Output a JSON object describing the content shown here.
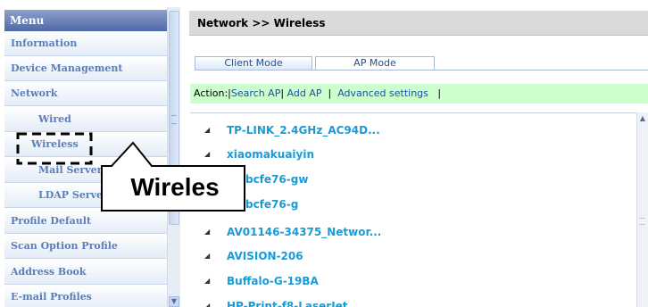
{
  "menu": {
    "title": "Menu",
    "items": [
      {
        "label": "Information"
      },
      {
        "label": "Device Management"
      },
      {
        "label": "Network"
      },
      {
        "label": "Wired"
      },
      {
        "label": "Wireless"
      },
      {
        "label": "Mail Server"
      },
      {
        "label": "LDAP Server"
      },
      {
        "label": "Profile Default"
      },
      {
        "label": "Scan Option Profile"
      },
      {
        "label": "Address Book"
      },
      {
        "label": "E-mail Profiles"
      }
    ]
  },
  "header": {
    "breadcrumb": "Network >> Wireless"
  },
  "tabs": [
    {
      "label": "Client Mode"
    },
    {
      "label": "AP Mode"
    }
  ],
  "action": {
    "prefix": "Action:",
    "search_ap": "Search AP",
    "add_ap": "Add AP",
    "advanced": "Advanced settings"
  },
  "networks": [
    {
      "ssid": "TP-LINK_2.4GHz_AC94D..."
    },
    {
      "ssid": "xiaomakuaiyin"
    },
    {
      "ssid": "-bcfe76-gw"
    },
    {
      "ssid": "-bcfe76-g"
    },
    {
      "ssid": "AV01146-34375_Networ..."
    },
    {
      "ssid": "AVISION-206"
    },
    {
      "ssid": "Buffalo-G-19BA"
    },
    {
      "ssid": "HP-Print-f8-LaserJet"
    }
  ],
  "callout": {
    "text": "Wireles"
  },
  "colors": {
    "action_bg": "#ccffcc",
    "ssid": "#1c9ad6",
    "link": "#1b50a8",
    "menu_text": "#5b7eb8"
  }
}
